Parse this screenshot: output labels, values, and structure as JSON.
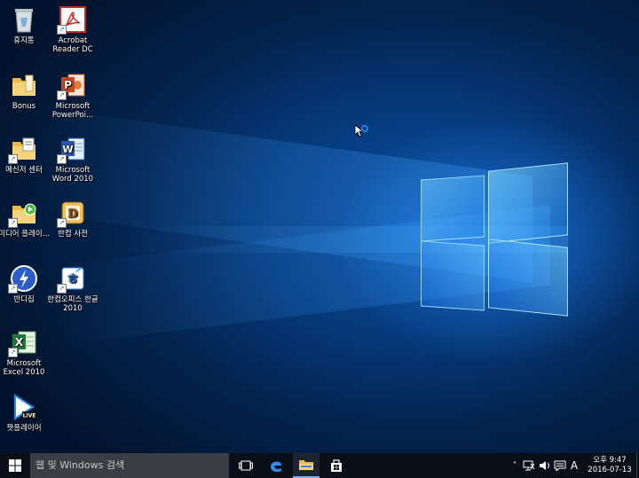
{
  "desktop": {
    "icons": [
      {
        "id": "recycle-bin",
        "label": "휴지통",
        "icon": "recycle-bin-icon"
      },
      {
        "id": "acrobat",
        "label": "Acrobat Reader DC",
        "icon": "acrobat-icon"
      },
      {
        "id": "bonus",
        "label": "Bonus",
        "icon": "folder-icon"
      },
      {
        "id": "powerpoint",
        "label": "Microsoft PowerPoi...",
        "icon": "powerpoint-icon"
      },
      {
        "id": "messenger",
        "label": "메신저 센터",
        "icon": "messenger-folder-icon"
      },
      {
        "id": "word",
        "label": "Microsoft Word 2010",
        "icon": "word-icon"
      },
      {
        "id": "media",
        "label": "미디어 플레이...",
        "icon": "media-folder-icon"
      },
      {
        "id": "hancom-dict",
        "label": "한컴 사전",
        "icon": "hancom-dictionary-icon"
      },
      {
        "id": "bandizip",
        "label": "반디집",
        "icon": "bandizip-icon"
      },
      {
        "id": "hangul",
        "label": "한컴오피스 한글 2010",
        "icon": "hangul-icon"
      },
      {
        "id": "excel",
        "label": "Microsoft Excel 2010",
        "icon": "excel-icon"
      },
      {
        "id": "potplayer",
        "label": "팟플레이어",
        "icon": "potplayer-icon",
        "badge": "LIVE"
      }
    ]
  },
  "taskbar": {
    "search_placeholder": "웹 및 Windows 검색",
    "ime_label": "A",
    "clock_time": "오후 9:47",
    "clock_date": "2016-07-13"
  },
  "colors": {
    "taskbar": "#0b0f17",
    "search": "#3a3d43",
    "accent": "#1e90ff"
  }
}
